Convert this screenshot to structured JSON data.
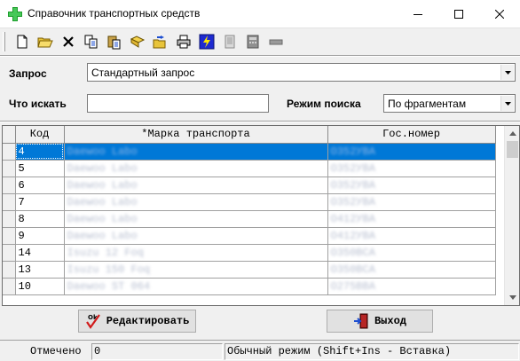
{
  "window": {
    "title": "Справочник транспортных средств"
  },
  "toolbar": {
    "icons": [
      "new-document-icon",
      "open-folder-icon",
      "delete-icon",
      "copy-icon",
      "paste-icon",
      "filter-icon",
      "open-icon",
      "print-icon",
      "run-icon",
      "report-icon",
      "calculator-icon",
      "minus-icon"
    ]
  },
  "query": {
    "label": "Запрос",
    "value": "Стандартный запрос"
  },
  "search": {
    "label": "Что искать",
    "value": "",
    "mode_label": "Режим поиска",
    "mode_value": "По фрагментам"
  },
  "grid": {
    "columns": [
      "Код",
      "*Марка транспорта",
      "Гос.номер"
    ],
    "rows": [
      {
        "kod": "4",
        "brand": "Daewoo Labo",
        "plate": "О352УВА"
      },
      {
        "kod": "5",
        "brand": "Daewoo Labo",
        "plate": "О352УВА"
      },
      {
        "kod": "6",
        "brand": "Daewoo Labo",
        "plate": "О352УВА"
      },
      {
        "kod": "7",
        "brand": "Daewoo Labo",
        "plate": "О352УВА"
      },
      {
        "kod": "8",
        "brand": "Daewoo Labo",
        "plate": "О412УВА"
      },
      {
        "kod": "9",
        "brand": "Daewoo Labo",
        "plate": "О412УВА"
      },
      {
        "kod": "14",
        "brand": "Isuzu 12 Foq",
        "plate": "О350ВСА"
      },
      {
        "kod": "13",
        "brand": "Isuzu 150 Foq",
        "plate": "О350ВСА"
      },
      {
        "kod": "10",
        "brand": "Daewoo ST 064",
        "plate": "О275ВВА"
      }
    ],
    "selected_index": 0
  },
  "buttons": {
    "edit_label": "Редактировать",
    "exit_label": "Выход"
  },
  "status": {
    "marked_label": "Отмечено",
    "marked_count": "0",
    "mode_text": "Обычный режим (Shift+Ins - Вставка)"
  },
  "colors": {
    "selection": "#0078d7",
    "window_bg": "#f0f0f0"
  }
}
